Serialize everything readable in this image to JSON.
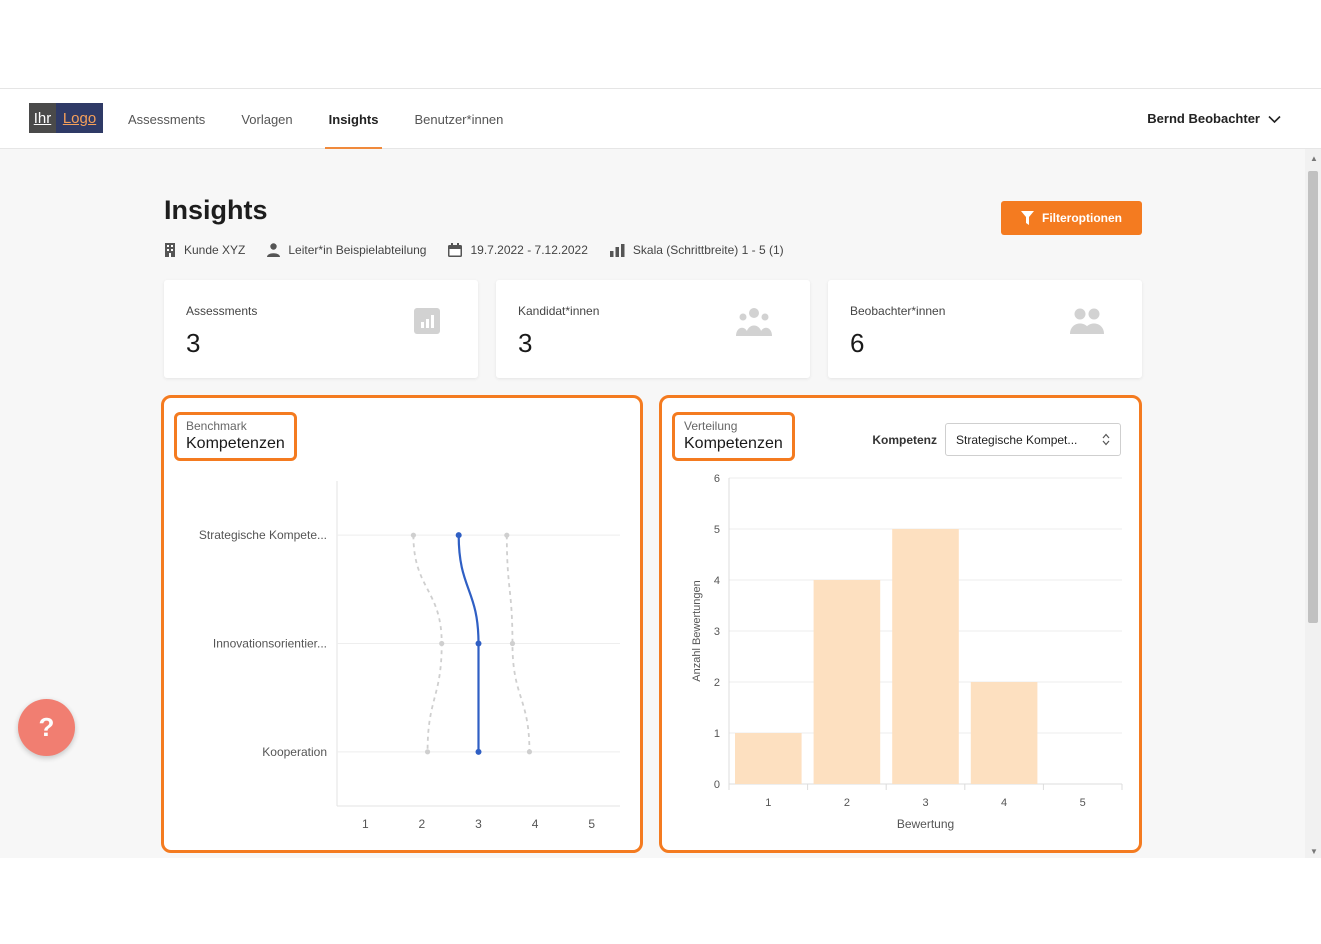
{
  "nav": {
    "logo_left": "Ihr",
    "logo_right": "Logo",
    "items": [
      "Assessments",
      "Vorlagen",
      "Insights",
      "Benutzer*innen"
    ],
    "active": "Insights",
    "user": "Bernd Beobachter"
  },
  "page": {
    "title": "Insights",
    "filter_button": "Filteroptionen",
    "meta": {
      "client": "Kunde XYZ",
      "role": "Leiter*in Beispielabteilung",
      "daterange": "19.7.2022 - 7.12.2022",
      "scale": "Skala (Schrittbreite) 1 - 5 (1)"
    }
  },
  "cards": [
    {
      "label": "Assessments",
      "value": "3",
      "icon": "bar-chart-icon"
    },
    {
      "label": "Kandidat*innen",
      "value": "3",
      "icon": "group-icon"
    },
    {
      "label": "Beobachter*innen",
      "value": "6",
      "icon": "users-icon"
    }
  ],
  "benchmark": {
    "subtitle": "Benchmark",
    "title": "Kompetenzen"
  },
  "distribution": {
    "subtitle": "Verteilung",
    "title": "Kompetenzen",
    "select_label": "Kompetenz",
    "select_value": "Strategische Kompet..."
  },
  "help_label": "?",
  "colors": {
    "accent": "#f47b20",
    "line_main": "#2f5fc4",
    "line_band": "#cfcfcf",
    "bar": "#fde0c0"
  },
  "chart_data": [
    {
      "type": "line",
      "orientation": "horizontal",
      "categories": [
        "Strategische Kompete...",
        "Innovationsorientier...",
        "Kooperation"
      ],
      "series": [
        {
          "values": [
            2.65,
            3.0,
            3.0
          ],
          "style": "solid"
        },
        {
          "values": [
            1.85,
            2.35,
            2.1
          ],
          "style": "dashed"
        },
        {
          "values": [
            3.5,
            3.6,
            3.9
          ],
          "style": "dashed"
        }
      ],
      "x_ticks": [
        "1",
        "2",
        "3",
        "4",
        "5"
      ],
      "xlim": [
        0.5,
        5.5
      ],
      "grid": true
    },
    {
      "type": "bar",
      "categories": [
        "1",
        "2",
        "3",
        "4",
        "5"
      ],
      "values": [
        1,
        4,
        5,
        2,
        0
      ],
      "xlabel": "Bewertung",
      "ylabel": "Anzahl Bewertungen",
      "ylim": [
        0,
        6
      ],
      "y_ticks": [
        "0",
        "1",
        "2",
        "3",
        "4",
        "5",
        "6"
      ],
      "grid": true
    }
  ]
}
